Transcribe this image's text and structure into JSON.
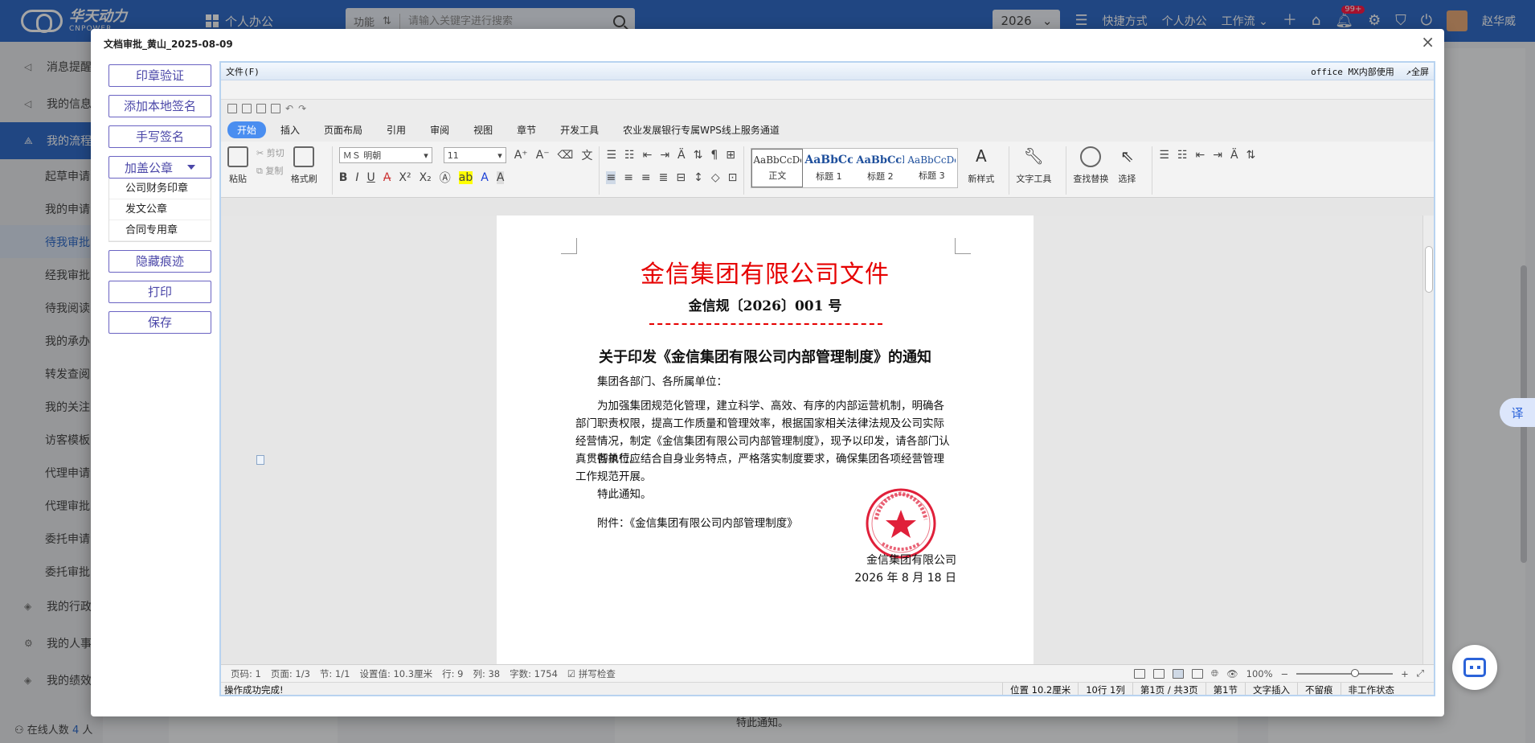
{
  "topbar": {
    "brand_cn": "华天动力",
    "brand_en": "CNPOWER",
    "home_label": "个人办公",
    "search_scope": "功能",
    "search_placeholder": "请输入关键字进行搜索",
    "year": "2026",
    "links": [
      "快捷方式",
      "个人办公",
      "工作流"
    ],
    "badge": "99+",
    "user": "赵华威"
  },
  "sidebar": {
    "items": [
      {
        "label": "消息提醒",
        "icon": "speaker-icon"
      },
      {
        "label": "我的信息",
        "icon": "speaker-icon"
      },
      {
        "label": "我的流程",
        "icon": "flow-icon",
        "active": true
      }
    ],
    "subitems": [
      "起草申请",
      "我的申请",
      "待我审批",
      "经我审批",
      "待我阅读",
      "我的承办",
      "转发查阅",
      "我的关注",
      "访客模板",
      "代理申请",
      "代理审批",
      "委托申请",
      "委托审批"
    ],
    "groups": [
      "我的行政",
      "我的人事",
      "我的绩效"
    ],
    "online_prefix": "在线人数",
    "online_count": "4",
    "online_suffix": "人"
  },
  "background": {
    "notice_text": "特此通知。",
    "translate_label": "译"
  },
  "modal": {
    "title": "文档审批_黄山_2025-08-09",
    "close": "×",
    "buttons": {
      "verify_seal": "印章验证",
      "add_local_sign": "添加本地签名",
      "handwrite_sign": "手写签名",
      "add_seal": "加盖公章",
      "hide_trace": "隐藏痕迹",
      "print": "打印",
      "save": "保存"
    },
    "seal_options": [
      "公司财务印章",
      "发文公章",
      "合同专用章"
    ]
  },
  "wps": {
    "menu_file": "文件(F)",
    "office_note": "office MX内部使用",
    "fullscreen": "↗全屏",
    "tabs": [
      "开始",
      "插入",
      "页面布局",
      "引用",
      "审阅",
      "视图",
      "章节",
      "开发工具",
      "农业发展银行专属WPS线上服务通道"
    ],
    "active_tab": "开始",
    "ribbon": {
      "paste": "粘贴",
      "cut": "剪切",
      "copy": "复制",
      "format_painter": "格式刷",
      "font": "ＭＳ 明朝",
      "size": "11",
      "styles": [
        {
          "sample": "AaBbCcDd",
          "name": "正文"
        },
        {
          "sample": "AaBbCc",
          "name": "标题 1"
        },
        {
          "sample": "AaBbCcD",
          "name": "标题 2"
        },
        {
          "sample": "AaBbCcDd",
          "name": "标题 3"
        }
      ],
      "new_style": "新样式",
      "text_tools": "文字工具",
      "find_replace": "查找替换",
      "select": "选择"
    },
    "status": {
      "page": "页码: 1",
      "pages": "页面: 1/3",
      "section": "节: 1/1",
      "setting": "设置值: 10.3厘米",
      "row": "行: 9",
      "col": "列: 38",
      "words": "字数: 1754",
      "spell": "拼写检查",
      "zoom": "100%"
    },
    "status2": {
      "message": "操作成功完成!",
      "position": "位置 10.2厘米",
      "rowcol": "10行 1列",
      "page_of": "第1页 / 共3页",
      "section": "第1节",
      "insert_mode": "文字插入",
      "track": "不留痕",
      "state": "非工作状态"
    }
  },
  "document": {
    "header_title": "金信集团有限公司文件",
    "doc_number": "金信规〔2026〕001 号",
    "notice_title": "关于印发《金信集团有限公司内部管理制度》的通知",
    "salutation": "集团各部门、各所属单位：",
    "para1": "为加强集团规范化管理，建立科学、高效、有序的内部运营机制，明确各部门职责权限，提高工作质量和管理效率，根据国家相关法律法规及公司实际经营情况，制定《金信集团有限公司内部管理制度》，现予以印发，请各部门认真贯彻执行。",
    "para2": "各单位应结合自身业务特点，严格落实制度要求，确保集团各项经营管理工作规范开展。",
    "closing": "特此通知。",
    "attachment": "附件：《金信集团有限公司内部管理制度》",
    "signer": "金信集团有限公司",
    "date": "2026 年 8 月 18 日"
  },
  "colors": {
    "brand": "#1b5cc3",
    "doc_red": "#e60000",
    "button_border": "#6a63c2"
  }
}
